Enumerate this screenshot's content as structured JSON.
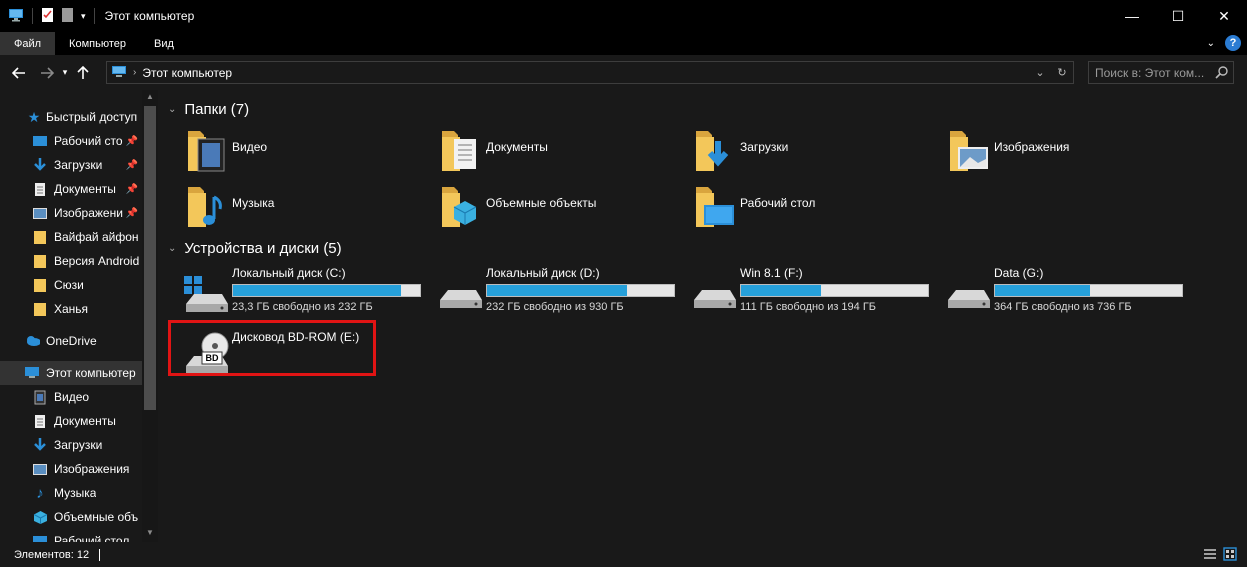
{
  "window": {
    "title": "Этот компьютер",
    "minimize_label": "—",
    "maximize_label": "☐",
    "close_label": "✕"
  },
  "ribbon": {
    "tabs": [
      "Файл",
      "Компьютер",
      "Вид"
    ],
    "help_label": "?"
  },
  "nav": {
    "address_text": "Этот компьютер",
    "search_placeholder": "Поиск в: Этот ком..."
  },
  "sidebar": {
    "quick_access": "Быстрый доступ",
    "items": [
      {
        "label": "Рабочий сто",
        "icon": "desktop-icon",
        "pinned": true
      },
      {
        "label": "Загрузки",
        "icon": "downloads-icon",
        "pinned": true
      },
      {
        "label": "Документы",
        "icon": "documents-icon",
        "pinned": true
      },
      {
        "label": "Изображени",
        "icon": "pictures-icon",
        "pinned": true
      },
      {
        "label": "Вайфай айфон",
        "icon": "folder-icon",
        "pinned": false
      },
      {
        "label": "Версия Android",
        "icon": "folder-icon",
        "pinned": false
      },
      {
        "label": "Сюзи",
        "icon": "folder-icon",
        "pinned": false
      },
      {
        "label": "Ханья",
        "icon": "folder-icon",
        "pinned": false
      }
    ],
    "onedrive": "OneDrive",
    "this_pc": "Этот компьютер",
    "pc_items": [
      {
        "label": "Видео",
        "icon": "video-icon"
      },
      {
        "label": "Документы",
        "icon": "documents-icon"
      },
      {
        "label": "Загрузки",
        "icon": "downloads-icon"
      },
      {
        "label": "Изображения",
        "icon": "pictures-icon"
      },
      {
        "label": "Музыка",
        "icon": "music-icon"
      },
      {
        "label": "Объемные объ",
        "icon": "3d-objects-icon"
      },
      {
        "label": "Рабочий стол",
        "icon": "desktop-icon"
      }
    ]
  },
  "folders": {
    "header": "Папки (7)",
    "items": [
      {
        "label": "Видео",
        "overlay": "video"
      },
      {
        "label": "Документы",
        "overlay": "document"
      },
      {
        "label": "Загрузки",
        "overlay": "download"
      },
      {
        "label": "Изображения",
        "overlay": "picture"
      },
      {
        "label": "Музыка",
        "overlay": "music"
      },
      {
        "label": "Объемные объекты",
        "overlay": "cube"
      },
      {
        "label": "Рабочий стол",
        "overlay": "desktop"
      }
    ]
  },
  "devices": {
    "header": "Устройства и диски (5)",
    "drives": [
      {
        "label": "Локальный диск (C:)",
        "free": "23,3 ГБ свободно из 232 ГБ",
        "used_fraction": 0.9,
        "windows": true
      },
      {
        "label": "Локальный диск (D:)",
        "free": "232 ГБ свободно из 930 ГБ",
        "used_fraction": 0.75,
        "windows": false
      },
      {
        "label": "Win 8.1 (F:)",
        "free": "111 ГБ свободно из 194 ГБ",
        "used_fraction": 0.43,
        "windows": false
      },
      {
        "label": "Data (G:)",
        "free": "364 ГБ свободно из 736 ГБ",
        "used_fraction": 0.51,
        "windows": false
      }
    ],
    "bd": {
      "label": "Дисковод BD-ROM (E:)",
      "badge": "BD"
    }
  },
  "status": {
    "items_count": "Элементов: 12"
  },
  "colors": {
    "background": "#191919",
    "chrome": "#000000",
    "accent": "#26a0da",
    "highlight": "#e11414",
    "folder": "#f3c75a"
  }
}
